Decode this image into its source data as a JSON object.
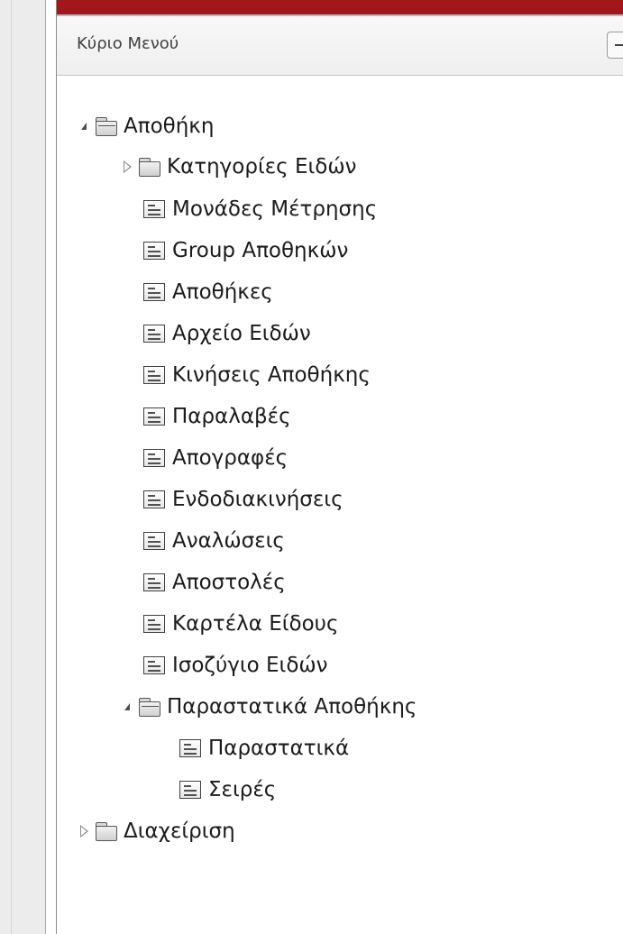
{
  "panel": {
    "title": "Κύριο Μενού"
  },
  "tree": {
    "root": {
      "label": "Αποθήκη",
      "children": [
        {
          "label": "Κατηγορίες Ειδών"
        },
        {
          "label": "Μονάδες Μέτρησης"
        },
        {
          "label": "Group Αποθηκών"
        },
        {
          "label": "Αποθήκες"
        },
        {
          "label": "Αρχείο Ειδών"
        },
        {
          "label": "Κινήσεις Αποθήκης"
        },
        {
          "label": "Παραλαβές"
        },
        {
          "label": "Απογραφές"
        },
        {
          "label": "Ενδοδιακινήσεις"
        },
        {
          "label": "Αναλώσεις"
        },
        {
          "label": "Αποστολές"
        },
        {
          "label": "Καρτέλα Είδους"
        },
        {
          "label": "Ισοζύγιο Ειδών"
        },
        {
          "label": "Παραστατικά Αποθήκης"
        },
        {
          "label": "Παραστατικά"
        },
        {
          "label": "Σειρές"
        }
      ]
    },
    "second_root": {
      "label": "Διαχείριση"
    }
  }
}
